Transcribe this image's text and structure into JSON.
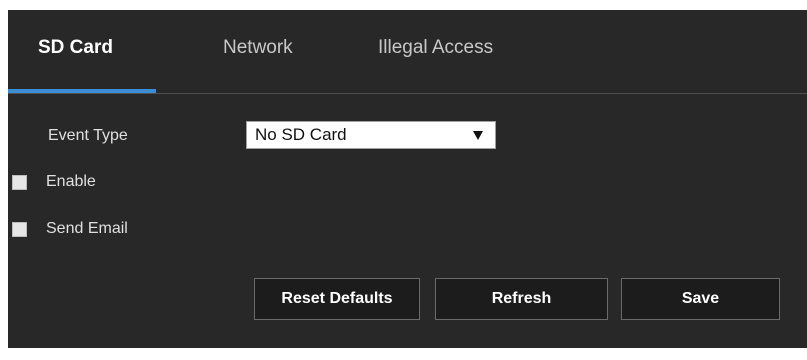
{
  "tabs": [
    {
      "label": "SD Card",
      "active": true
    },
    {
      "label": "Network",
      "active": false
    },
    {
      "label": "Illegal Access",
      "active": false
    }
  ],
  "form": {
    "event_type_label": "Event Type",
    "event_type_value": "No SD Card",
    "enable_label": "Enable",
    "enable_checked": false,
    "send_email_label": "Send Email",
    "send_email_checked": false
  },
  "buttons": {
    "reset_label": "Reset Defaults",
    "refresh_label": "Refresh",
    "save_label": "Save"
  },
  "colors": {
    "panel_background": "#282828",
    "active_tab_underline": "#3b8ed6",
    "active_tab_text": "#ffffff",
    "inactive_tab_text": "#c8c8c8"
  },
  "icons": {
    "select_arrow": "dropdown-arrow-icon"
  }
}
